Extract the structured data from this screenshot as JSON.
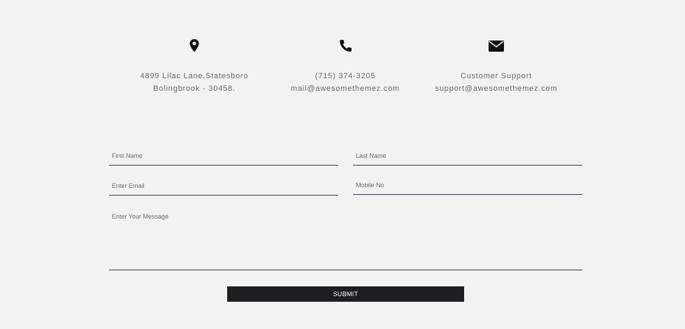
{
  "contact": {
    "address": {
      "icon": "map-pin-icon",
      "line1": "4899 Lilac Lane,Statesboro",
      "line2": "Bolingbrook - 30458."
    },
    "phone": {
      "icon": "phone-icon",
      "line1": "(715) 374-3205",
      "line2": "mail@awesomethemez.com"
    },
    "support": {
      "icon": "envelope-icon",
      "line1": "Customer Support",
      "line2": "support@awesomethemez.com"
    }
  },
  "form": {
    "first_name": {
      "placeholder": "First Name",
      "value": ""
    },
    "last_name": {
      "placeholder": "Last Name",
      "value": ""
    },
    "email": {
      "placeholder": "Enter Email",
      "value": ""
    },
    "mobile": {
      "placeholder": "Mobile No",
      "value": ""
    },
    "message": {
      "placeholder": "Enter Your Message",
      "value": ""
    },
    "submit_label": "SUBMIT"
  },
  "colors": {
    "background": "#f2f2f2",
    "text": "#666666",
    "underline": "#34394a",
    "button": "#1e1f21"
  }
}
